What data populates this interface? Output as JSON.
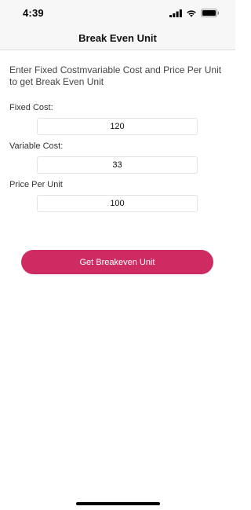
{
  "status_bar": {
    "time": "4:39",
    "icons": [
      "signal-icon",
      "wifi-icon",
      "battery-icon"
    ]
  },
  "nav": {
    "title": "Break Even Unit"
  },
  "instructions": "Enter Fixed Costmvariable Cost and Price Per Unit to get Break Even Unit",
  "form": {
    "fixed_cost": {
      "label": "Fixed Cost:",
      "value": "120"
    },
    "variable_cost": {
      "label": "Variable Cost:",
      "value": "33"
    },
    "price_per_unit": {
      "label": "Price Per Unit",
      "value": "100"
    }
  },
  "button": {
    "label": "Get Breakeven Unit",
    "color": "#cf2b63"
  }
}
